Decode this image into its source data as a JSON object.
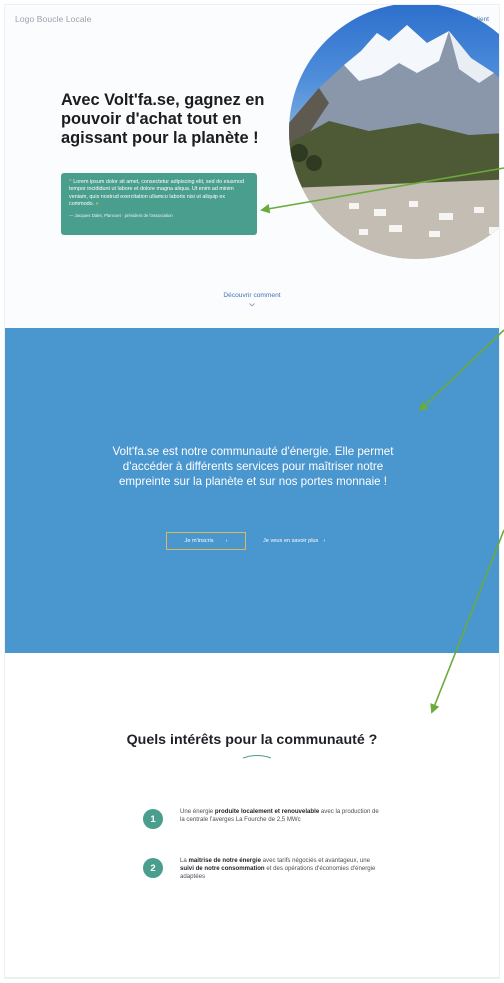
{
  "header": {
    "logo": "Logo Boucle Locale",
    "account_label": "Espace client"
  },
  "hero": {
    "title": "Avec Volt'fa.se, gagnez en pouvoir d'achat tout en agissant pour la planète !",
    "quote_text": "Lorem ipsum dolor sit amet, consectetur adipiscing elit, sed do eiusmod tempor incididunt ut labore et dolore magna aliqua. Ut enim ad minim veniam, quis nostrud exercitation ullamco laboris nisi ut aliquip ex commodo.",
    "quote_author": "— Jacques Dalet, Plancoet · président de l'association",
    "discover": "Découvrir comment"
  },
  "band": {
    "text": "Volt'fa.se est notre communauté d'énergie. Elle permet d'accéder à différents services pour maîtriser notre empreinte sur la planète et sur nos portes monnaie !",
    "primary_button": "Je m'inscris",
    "secondary_button": "Je veux en savoir plus"
  },
  "interests": {
    "title": "Quels intérêts pour la communauté ?",
    "items": [
      {
        "number": "1",
        "before": "Une énergie ",
        "bold1": "produite localement et renouvelable",
        "middle": " avec la production de la centrale l'averges La Fourche de 2,5 MWc",
        "bold2": "",
        "after": ""
      },
      {
        "number": "2",
        "before": "La ",
        "bold1": "maitrise de notre énergie",
        "middle": " avec tarifs négociés et avantageux, une ",
        "bold2": "suivi de notre consommation",
        "after": " et des opérations d'économies d'énergie adaptées"
      }
    ]
  },
  "colors": {
    "accent_green": "#4a9e8d",
    "band_blue": "#4a96cf",
    "gold": "#d7bb5c",
    "annotation_arrow": "#6aab3a"
  },
  "icons": [
    "user-icon",
    "quote-icon",
    "chevron-down-icon",
    "chevron-right-icon"
  ]
}
